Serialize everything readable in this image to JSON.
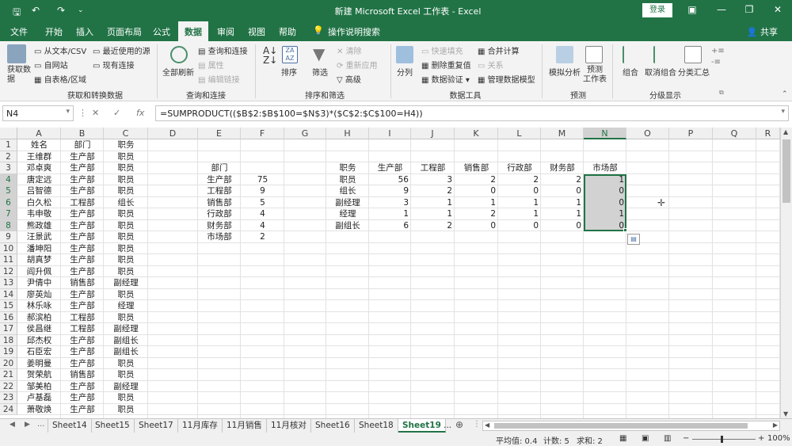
{
  "titlebar": {
    "undo": "↶",
    "redo": "↷",
    "title": "新建 Microsoft Excel 工作表 - Excel",
    "login": "登录"
  },
  "tabs": [
    "文件",
    "开始",
    "插入",
    "页面布局",
    "公式",
    "数据",
    "审阅",
    "视图",
    "帮助",
    "操作说明搜索"
  ],
  "share": "共享",
  "ribbon": {
    "get_data": "获取数\n据",
    "from_text": "从文本/CSV",
    "from_web": "自网站",
    "from_table": "自表格/区域",
    "recent": "最近使用的源",
    "existing": "现有连接",
    "group1": "获取和转换数据",
    "refresh_all": "全部刷新",
    "queries": "查询和连接",
    "properties": "属性",
    "edit_links": "编辑链接",
    "group2": "查询和连接",
    "sort": "排序",
    "filter": "筛选",
    "clear": "清除",
    "reapply": "重新应用",
    "advanced": "高级",
    "group3": "排序和筛选",
    "split": "分列",
    "flash_fill": "快速填充",
    "remove_dup": "删除重复值",
    "validate": "数据验证",
    "consolidate": "合并计算",
    "relations": "关系",
    "model": "管理数据模型",
    "group4": "数据工具",
    "whatif": "模拟分析",
    "forecast": "预测\n工作表",
    "group5": "预测",
    "group_btn": "组合",
    "ungroup": "取消组合",
    "subtotal": "分类汇总",
    "group6": "分级显示"
  },
  "formula_bar": {
    "name_box": "N4",
    "formula": "=SUMPRODUCT(($B$2:$B$100=$N$3)*($C$2:$C$100=H4))"
  },
  "columns": [
    "A",
    "B",
    "C",
    "D",
    "E",
    "F",
    "G",
    "H",
    "I",
    "J",
    "K",
    "L",
    "M",
    "N",
    "O",
    "P",
    "Q",
    "R"
  ],
  "rows": [
    "1",
    "2",
    "3",
    "4",
    "5",
    "6",
    "7",
    "8",
    "9",
    "10",
    "11",
    "12",
    "13",
    "14",
    "15",
    "16",
    "17",
    "18",
    "19",
    "20",
    "21",
    "22",
    "23",
    "24"
  ],
  "col_a": [
    "姓名",
    "王维群",
    "邓卓爽",
    "唐定远",
    "吕智德",
    "白久松",
    "韦申敬",
    "熊政雄",
    "汪景武",
    "潘坤阳",
    "胡真梦",
    "阎升佩",
    "尹倩中",
    "廖英灿",
    "林乐咏",
    "郝滨柏",
    "侯昌继",
    "邱杰权",
    "石臣宏",
    "姜明曼",
    "贺荣航",
    "邹美柏",
    "卢基磊",
    "萧敬焕"
  ],
  "col_b": [
    "部门",
    "生产部",
    "生产部",
    "生产部",
    "生产部",
    "工程部",
    "生产部",
    "生产部",
    "生产部",
    "生产部",
    "生产部",
    "生产部",
    "销售部",
    "生产部",
    "生产部",
    "工程部",
    "工程部",
    "生产部",
    "生产部",
    "生产部",
    "销售部",
    "生产部",
    "生产部",
    "生产部"
  ],
  "col_c": [
    "职务",
    "职员",
    "职员",
    "职员",
    "职员",
    "组长",
    "职员",
    "职员",
    "职员",
    "职员",
    "职员",
    "职员",
    "副经理",
    "职员",
    "经理",
    "职员",
    "副经理",
    "副组长",
    "副组长",
    "职员",
    "职员",
    "副经理",
    "职员",
    "职员"
  ],
  "summary_e": [
    "部门",
    "生产部",
    "工程部",
    "销售部",
    "行政部",
    "财务部",
    "市场部"
  ],
  "summary_f": [
    "",
    "75",
    "9",
    "5",
    "4",
    "4",
    "2"
  ],
  "matrix_header": [
    "职务",
    "生产部",
    "工程部",
    "销售部",
    "行政部",
    "财务部",
    "市场部"
  ],
  "matrix_rows": [
    [
      "职员",
      "56",
      "3",
      "2",
      "2",
      "2",
      "1"
    ],
    [
      "组长",
      "9",
      "2",
      "0",
      "0",
      "0",
      "0"
    ],
    [
      "副经理",
      "3",
      "1",
      "1",
      "1",
      "1",
      "0"
    ],
    [
      "经理",
      "1",
      "1",
      "2",
      "1",
      "1",
      "1"
    ],
    [
      "副组长",
      "6",
      "2",
      "0",
      "0",
      "0",
      "0"
    ]
  ],
  "sheets": [
    "Sheet14",
    "Sheet15",
    "Sheet17",
    "11月库存",
    "11月销售",
    "11月核对",
    "Sheet16",
    "Sheet18",
    "Sheet19",
    "..."
  ],
  "active_sheet": "Sheet19",
  "status": {
    "avg": "平均值: 0.4",
    "count": "计数: 5",
    "sum": "求和: 2",
    "zoom": "100%"
  },
  "colors": {
    "accent": "#217346",
    "selected": "#d2d2d2"
  },
  "icons": [
    "save-icon",
    "undo-icon",
    "redo-icon",
    "ribbon-display-icon",
    "minimize-icon",
    "restore-icon",
    "close-icon",
    "lightbulb-icon",
    "user-icon",
    "paste-options-icon",
    "add-sheet-icon",
    "plus-cursor-icon"
  ]
}
